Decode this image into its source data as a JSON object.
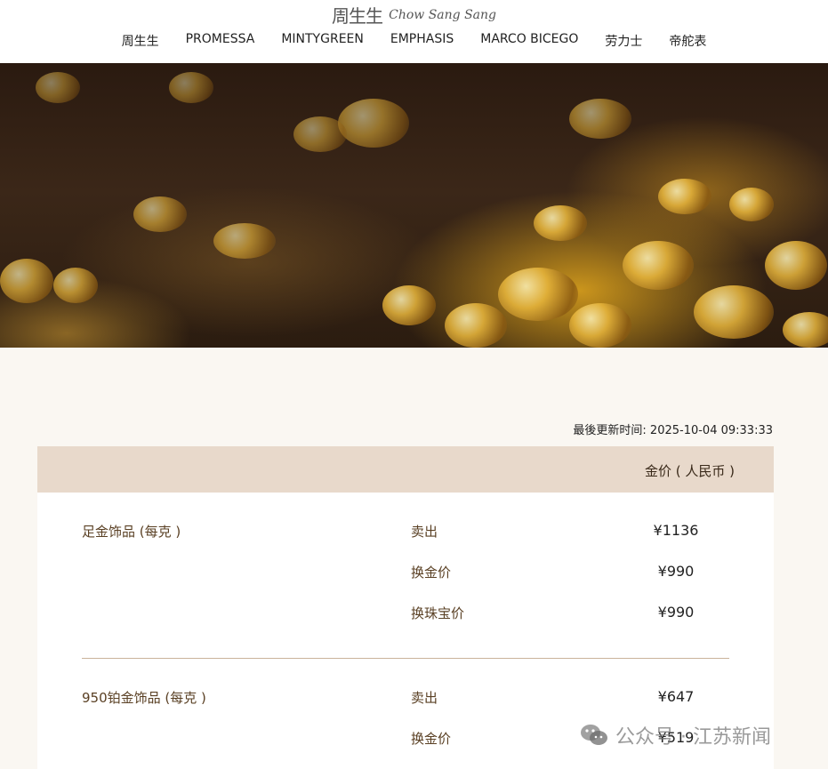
{
  "brand": {
    "logo_cn": "周生生",
    "logo_en": "Chow Sang Sang"
  },
  "nav": {
    "items": [
      "周生生",
      "PROMESSA",
      "MINTYGREEN",
      "EMPHASIS",
      "MARCO BICEGO",
      "劳力士",
      "帝舵表"
    ]
  },
  "update": {
    "label": "最後更新时间:",
    "timestamp": "2025-10-04 09:33:33"
  },
  "table": {
    "column_title": "金价 ( 人民币 )",
    "categories": [
      {
        "name": "足金饰品 (每克 )",
        "rows": [
          {
            "label": "卖出",
            "value": "¥1136"
          },
          {
            "label": "换金价",
            "value": "¥990"
          },
          {
            "label": "换珠宝价",
            "value": "¥990"
          }
        ]
      },
      {
        "name": "950铂金饰品 (每克 )",
        "rows": [
          {
            "label": "卖出",
            "value": "¥647"
          },
          {
            "label": "换金价",
            "value": "¥519"
          }
        ]
      }
    ]
  },
  "watermark": {
    "text": "公众号 · 江苏新闻",
    "icon": "wechat-icon"
  },
  "colors": {
    "page_bg": "#faf7f2",
    "table_header_bg": "#e8d9cb",
    "label_brown": "#5a4024",
    "divider": "#c9b29a"
  }
}
